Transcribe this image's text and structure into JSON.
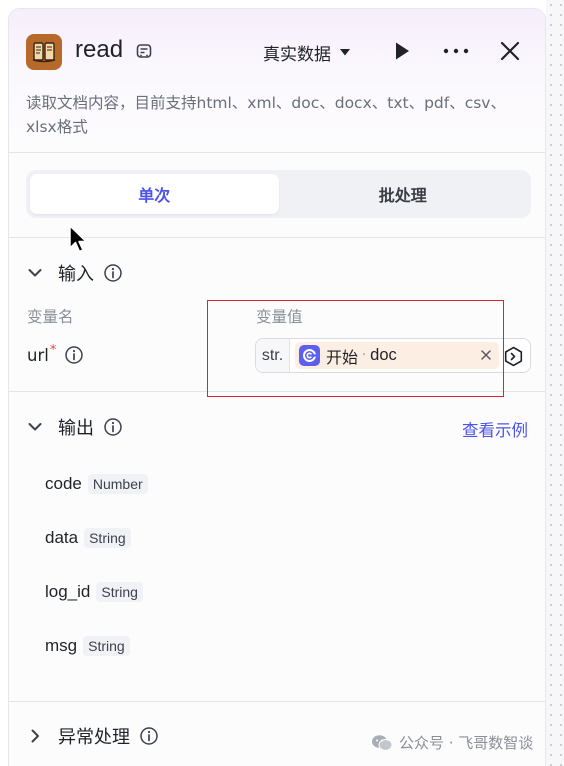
{
  "header": {
    "title": "read",
    "data_source": "真实数据",
    "icon": "book-icon"
  },
  "description": "读取文档内容，目前支持html、xml、doc、docx、txt、pdf、csv、xlsx格式",
  "mode_tabs": [
    {
      "label": "单次",
      "active": true
    },
    {
      "label": "批处理",
      "active": false
    }
  ],
  "input": {
    "section_title": "输入",
    "col_name_label": "变量名",
    "col_value_label": "变量值",
    "params": [
      {
        "name": "url",
        "required_mark": "*",
        "type_tag": "str.",
        "ref_node": "开始",
        "ref_separator": "·",
        "ref_var": "doc"
      }
    ]
  },
  "output": {
    "section_title": "输出",
    "view_example": "查看示例",
    "fields": [
      {
        "name": "code",
        "type": "Number"
      },
      {
        "name": "data",
        "type": "String"
      },
      {
        "name": "log_id",
        "type": "String"
      },
      {
        "name": "msg",
        "type": "String"
      }
    ]
  },
  "exception": {
    "section_title": "异常处理"
  },
  "watermark": "公众号 · 飞哥数智谈",
  "colors": {
    "accent": "#4d53e8",
    "highlight_box": "#d9262c",
    "ref_chip_bg": "#fdeee4",
    "node_icon_bg": "#b7692a"
  }
}
